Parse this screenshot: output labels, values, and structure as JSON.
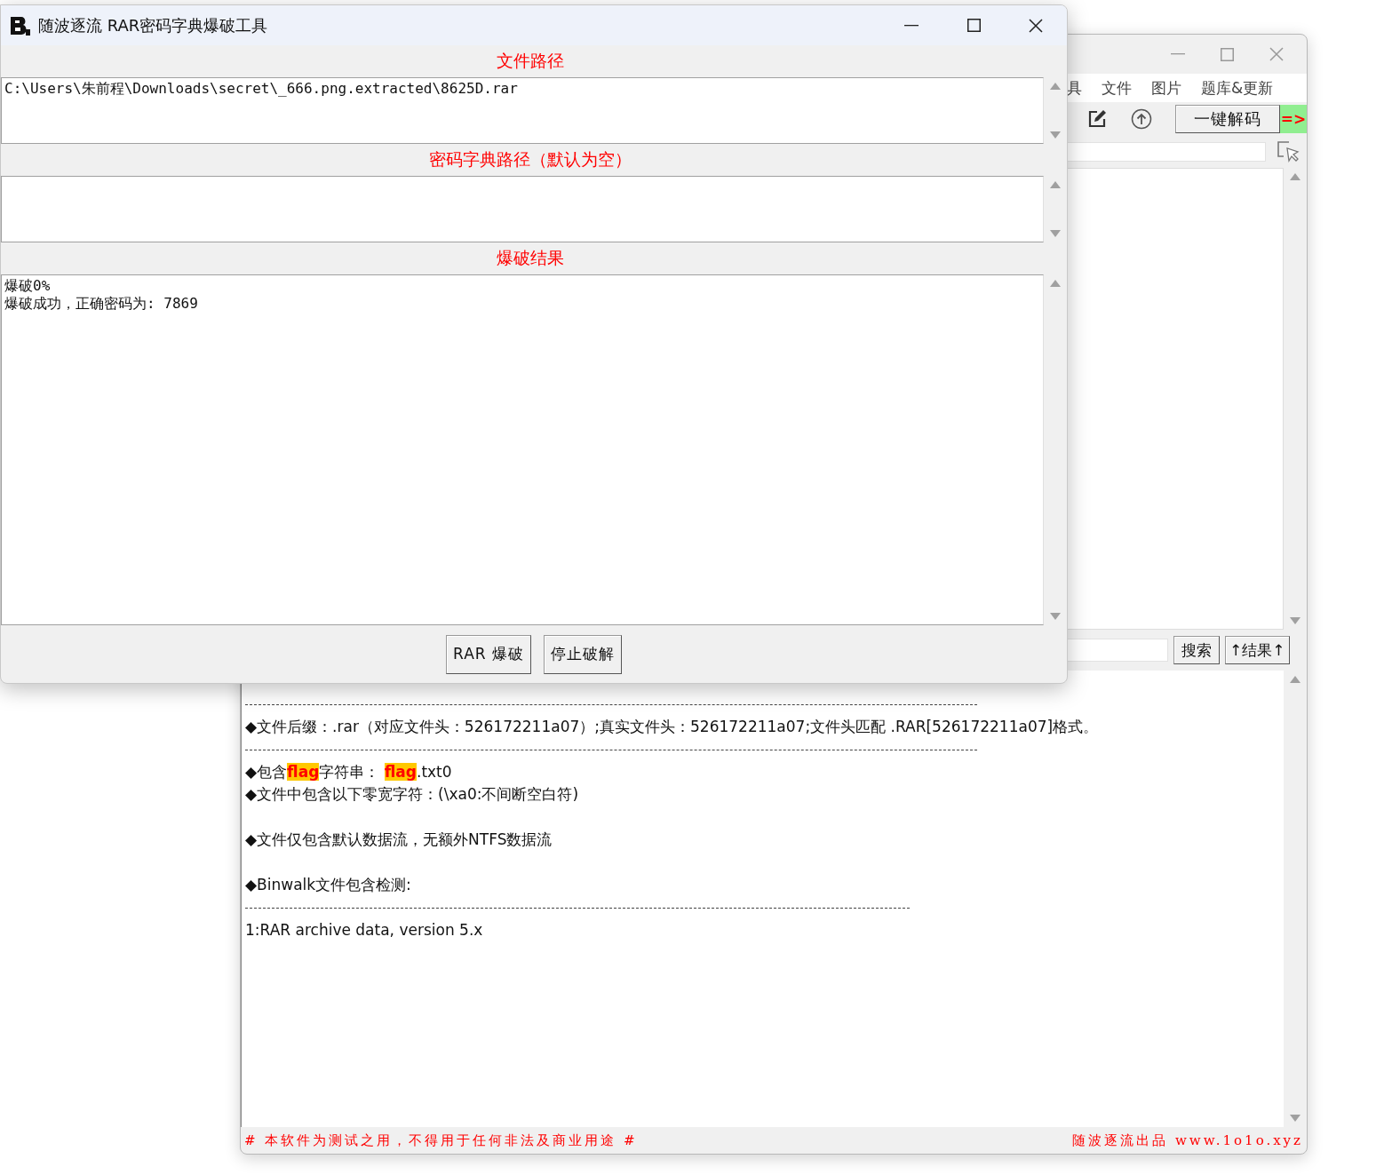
{
  "back_window": {
    "menu": [
      "具",
      "文件",
      "图片",
      "题库&更新"
    ],
    "decode_button": "一键解码",
    "indicator": "=>",
    "search_button": "搜索",
    "result_button": "↑结果↑",
    "output": [
      {
        "kind": "rule"
      },
      {
        "kind": "text",
        "text": "◆文件后缀：.rar（对应文件头：526172211a07）;真实文件头：526172211a07;文件头匹配 .RAR[526172211a07]格式。"
      },
      {
        "kind": "rule"
      },
      {
        "kind": "text",
        "text": "◆包含**flag**字符串：  **flag**.txt0"
      },
      {
        "kind": "text",
        "text": "◆文件中包含以下零宽字符：(\\xa0:不间断空白符)"
      },
      {
        "kind": "gap"
      },
      {
        "kind": "text",
        "text": "◆文件仅包含默认数据流，无额外NTFS数据流"
      },
      {
        "kind": "gap"
      },
      {
        "kind": "text",
        "text": "◆Binwalk文件包含检测:"
      },
      {
        "kind": "rule",
        "short": true
      },
      {
        "kind": "text",
        "text": "1:RAR archive data, version 5.x"
      }
    ],
    "footer": {
      "notice": "# 本软件为测试之用，不得用于任何非法及商业用途 #",
      "credit": "随波逐流出品 www.1o1o.xyz"
    }
  },
  "front_window": {
    "title": "随波逐流 RAR密码字典爆破工具",
    "sections": [
      {
        "label": "文件路径",
        "value": "C:\\Users\\朱前程\\Downloads\\secret\\_666.png.extracted\\8625D.rar",
        "kind": "field"
      },
      {
        "label": "密码字典路径（默认为空）",
        "kind": "field"
      },
      {
        "label": "爆破结果",
        "value": "爆破0%\n爆破成功，正确密码为: 7869",
        "kind": "log"
      }
    ],
    "buttons": [
      "RAR 爆破",
      "停止破解"
    ]
  }
}
